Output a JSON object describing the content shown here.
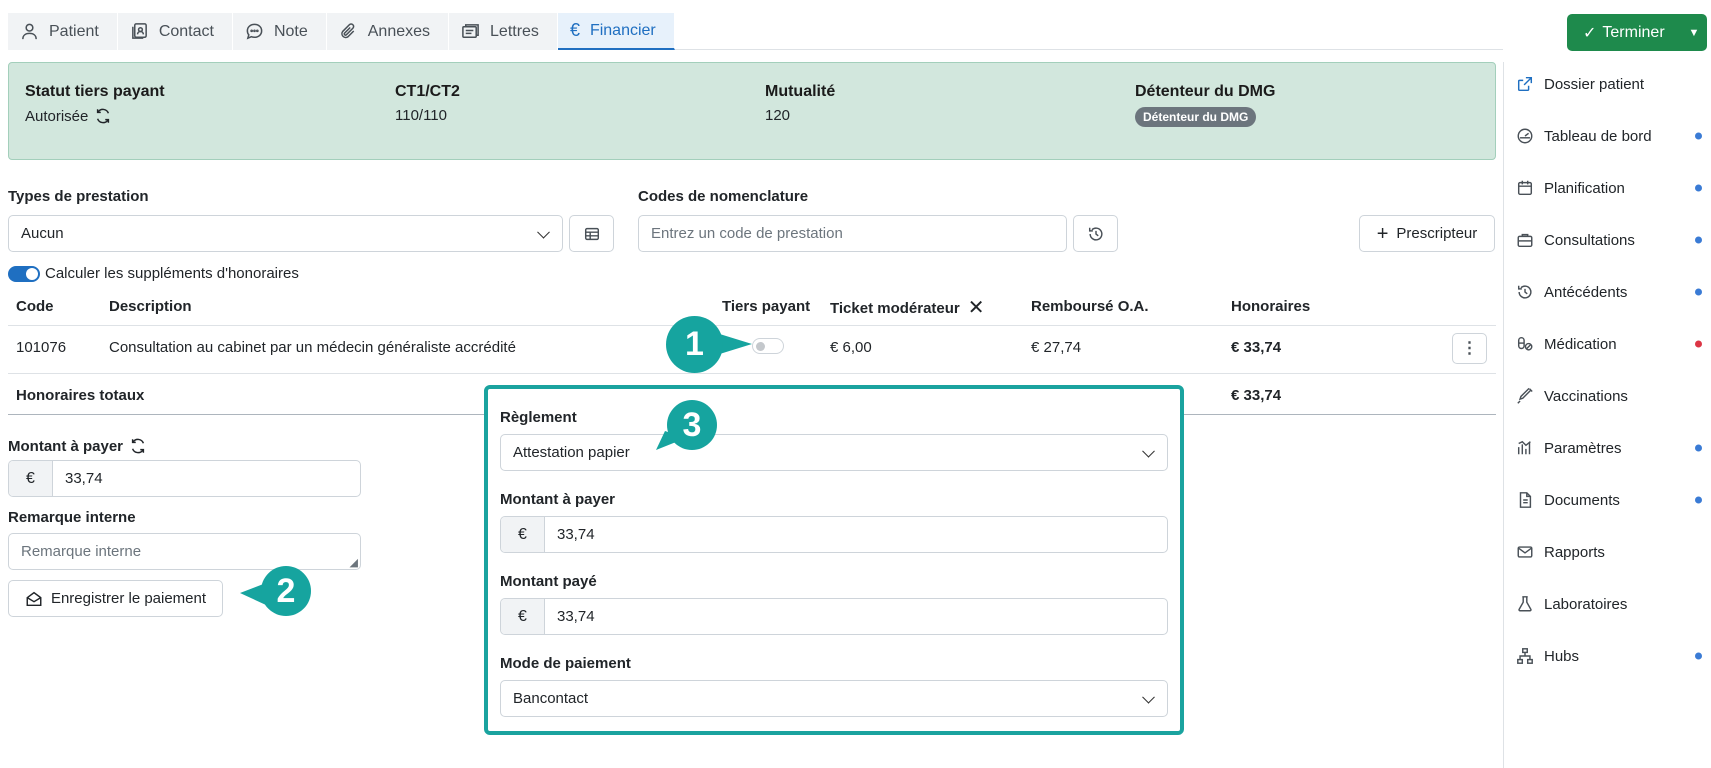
{
  "tabs": [
    {
      "label": "Patient",
      "icon": "person-icon"
    },
    {
      "label": "Contact",
      "icon": "contact-card-icon"
    },
    {
      "label": "Note",
      "icon": "chat-icon"
    },
    {
      "label": "Annexes",
      "icon": "paperclip-icon"
    },
    {
      "label": "Lettres",
      "icon": "letters-icon"
    },
    {
      "label": "Financier",
      "icon": "euro-icon",
      "active": true
    }
  ],
  "terminer": {
    "label": "Terminer"
  },
  "status": {
    "tiers_payant_label": "Statut tiers payant",
    "tiers_payant_value": "Autorisée",
    "ct_label": "CT1/CT2",
    "ct_value": "110/110",
    "mutualite_label": "Mutualité",
    "mutualite_value": "120",
    "dmg_label": "Détenteur du DMG",
    "dmg_badge": "Détenteur du DMG"
  },
  "form": {
    "types_label": "Types de prestation",
    "types_value": "Aucun",
    "codes_label": "Codes de nomenclature",
    "codes_placeholder": "Entrez un code de prestation",
    "prescripteur_label": "Prescripteur",
    "supplements_label": "Calculer les suppléments d'honoraires"
  },
  "table": {
    "headers": {
      "code": "Code",
      "description": "Description",
      "tiers_payant": "Tiers payant",
      "ticket": "Ticket modérateur",
      "rembourse": "Remboursé O.A.",
      "honoraires": "Honoraires"
    },
    "rows": [
      {
        "code": "101076",
        "description": "Consultation au cabinet par un médecin généraliste accrédité",
        "ticket": "€ 6,00",
        "rembourse": "€ 27,74",
        "honoraires": "€ 33,74"
      }
    ],
    "total_label": "Honoraires totaux",
    "total_value": "€ 33,74"
  },
  "payment": {
    "montant_label": "Montant à payer",
    "currency": "€",
    "montant_value": "33,74",
    "remarque_label": "Remarque interne",
    "remarque_placeholder": "Remarque interne",
    "enregistrer_label": "Enregistrer le paiement"
  },
  "popup": {
    "reglement_label": "Règlement",
    "reglement_value": "Attestation papier",
    "montant_label": "Montant à payer",
    "montant_value": "33,74",
    "paye_label": "Montant payé",
    "paye_value": "33,74",
    "mode_label": "Mode de paiement",
    "mode_value": "Bancontact"
  },
  "markers": [
    "1",
    "2",
    "3"
  ],
  "sidebar": [
    {
      "label": "Dossier patient",
      "icon": "external-link-icon",
      "dot": null
    },
    {
      "label": "Tableau de bord",
      "icon": "dashboard-icon",
      "dot": "#3a7bd5"
    },
    {
      "label": "Planification",
      "icon": "calendar-icon",
      "dot": "#3a7bd5"
    },
    {
      "label": "Consultations",
      "icon": "briefcase-icon",
      "dot": "#3a7bd5"
    },
    {
      "label": "Antécédents",
      "icon": "history-icon",
      "dot": "#3a7bd5"
    },
    {
      "label": "Médication",
      "icon": "pills-icon",
      "dot": "#dc3545"
    },
    {
      "label": "Vaccinations",
      "icon": "syringe-icon",
      "dot": null
    },
    {
      "label": "Paramètres",
      "icon": "chart-icon",
      "dot": "#3a7bd5"
    },
    {
      "label": "Documents",
      "icon": "document-icon",
      "dot": "#3a7bd5"
    },
    {
      "label": "Rapports",
      "icon": "envelope-icon",
      "dot": null
    },
    {
      "label": "Laboratoires",
      "icon": "flask-icon",
      "dot": null
    },
    {
      "label": "Hubs",
      "icon": "network-icon",
      "dot": "#3a7bd5"
    }
  ],
  "colors": {
    "accent": "#1f6fc1",
    "success": "#1e8a4c",
    "status_bg": "#d2e7dd",
    "highlight": "#1aa39f"
  }
}
